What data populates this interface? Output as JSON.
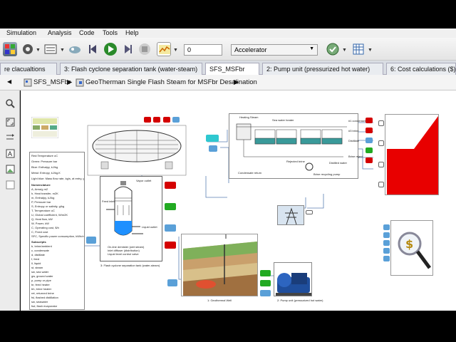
{
  "menu": [
    "Simulation",
    "Analysis",
    "Code",
    "Tools",
    "Help"
  ],
  "toolbar": {
    "sim_time": "0",
    "mode": "Accelerator"
  },
  "tabs": [
    "re clacualtions",
    "3: Flash cyclone separation tank (water-steam)",
    "SFS_MSFbr",
    "2: Pump unit (pressurized hot water)",
    "6: Cost calculations ($)"
  ],
  "breadcrumb": {
    "root": "SFS_MSFbr",
    "model": "GeoTherman Single Flash Steam for MSFbr Desalination"
  },
  "blocks": {
    "flash_tank": "3: Flash cyclone separation tank (water-steam)",
    "well": "1: Geothermal Well",
    "pump": "2: Pump unit (pressurized hot water)",
    "vapor_outlet": "Vapor outlet",
    "liquid_outlet": "Liquid outlet",
    "feed_inlet": "Feed inlet",
    "legend_1": "On-line demister (wet steam)",
    "legend_2": "Inlet diffuser (distribution)",
    "legend_3": "Liquid level control valve",
    "heating_steam": "Heating Steam",
    "sea_water_heater": "Sea water heater",
    "condensate_return": "Condensate return",
    "brine_recycling_pump": "Brine recycling pump",
    "distilled_water": "Distilled water",
    "rejected_brine": "Rejected brine",
    "sea_water": "Sea water"
  },
  "side_ports": [
    "#1 condenser",
    "#3 brine",
    "Distillate",
    "Brine reject"
  ],
  "signal_tags": [
    "Brine",
    "Pressure",
    "Steam",
    "Water"
  ],
  "param_list": {
    "header": [
      "Red:Temperature oC",
      "Green: Pressure bar",
      "Blue: Enthalpy, kJ/kg",
      "Metal: Entropy, kJ/kg.K",
      "Light blue: Mass flow rate, kg/s, at entry, g/kg"
    ],
    "nomenclature": "Nomenclature",
    "items": [
      "A, Area/g m2",
      "h, Heat transfer, m2K",
      "m, Enthalpy, kJ/kg",
      "P, Pressure bar",
      "S, Entropy or salinity, g/kg",
      "T, Temperature oC",
      "U, Global coefficient, W/m2K",
      "Q, Heat flow, kW",
      "W, Power, kW",
      "C, Operating cost, $/h",
      "C, Fixed cost",
      "SFC, Specific power consumption, kWh/m3"
    ],
    "subscripts": "Subscripts",
    "subs": [
      "b, brine/ambient",
      "c, condensate",
      "d, distillate",
      "f, feed",
      "ll, liquid",
      "st, steam",
      "sw, sea water",
      "gw, ground water",
      "p, pump or pipe",
      "br, feed heater",
      "bh, brine heater",
      "ret, returned brine",
      "fsl, flashed distillation",
      "sw, seawater",
      "fsd, flash evaporator",
      "s, system",
      "w, well",
      "th, thermal",
      "GOR, gain output ratio",
      "SFC, specific power",
      "ex, exergy",
      "e, electrical",
      "th, thermal"
    ]
  }
}
